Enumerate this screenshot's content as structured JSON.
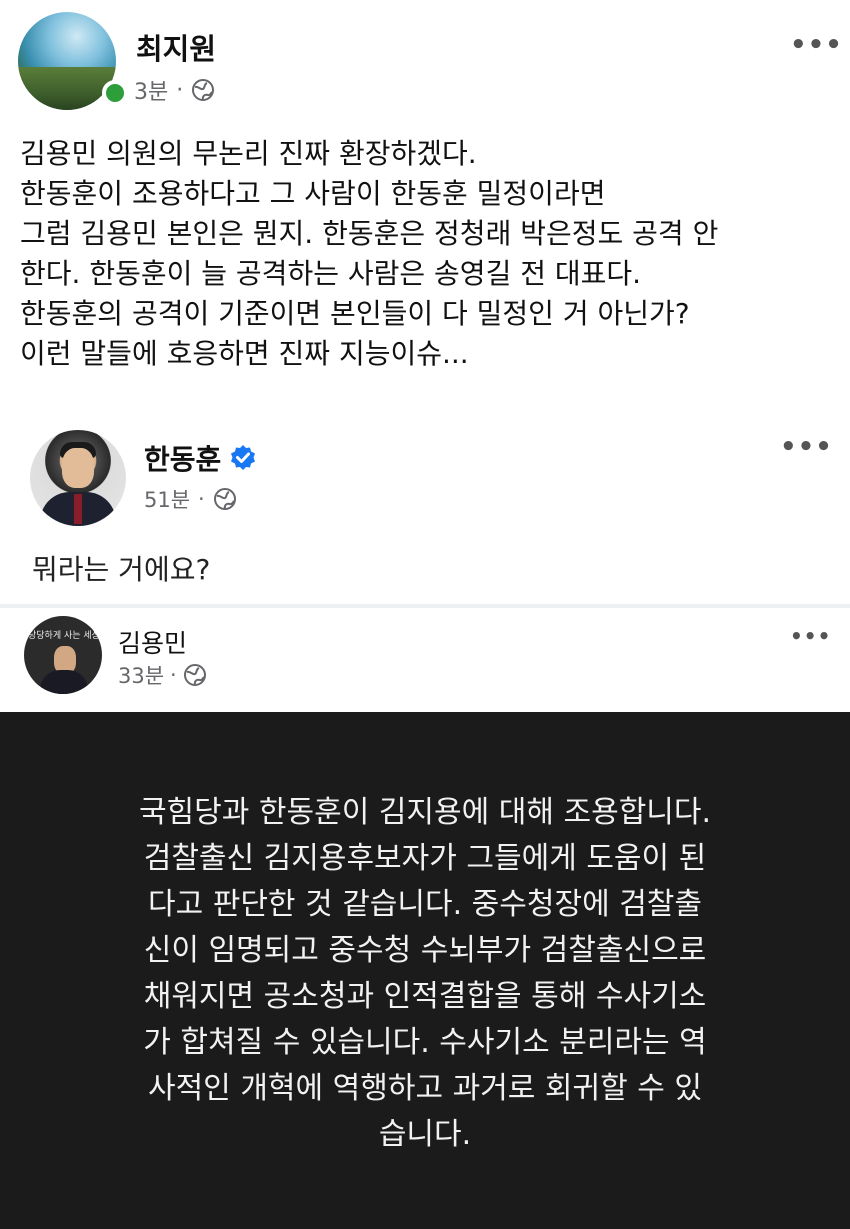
{
  "post": {
    "author": "최지원",
    "time": "3분",
    "separator": "·",
    "avatar_icon": "sea-landscape-avatar",
    "status_color": "#2e9e3a",
    "lines": [
      "김용민 의원의 무논리 진짜 환장하겠다.",
      "한동훈이 조용하다고 그 사람이 한동훈 밀정이라면",
      "그럼 김용민 본인은 뭔지. 한동훈은 정청래 박은정도 공격 안",
      "한다. 한동훈이 늘 공격하는 사람은 송영길 전 대표다.",
      "한동훈의 공격이 기준이면 본인들이 다 밀정인 거 아닌가?",
      "이런 말들에 호응하면 진짜 지능이슈..."
    ]
  },
  "shared1": {
    "author": "한동훈",
    "time": "51분",
    "separator": "·",
    "text": "뭐라는 거에요?",
    "verified_color": "#1877f2"
  },
  "shared2": {
    "author": "김용민",
    "time": "33분",
    "separator": "·",
    "avatar_caption": "당당하게 사는 세상",
    "panel_lines": [
      "국힘당과 한동훈이 김지용에 대해 조용합니다.",
      "검찰출신 김지용후보자가 그들에게 도움이 된",
      "다고 판단한 것 같습니다. 중수청장에 검찰출",
      "신이 임명되고 중수청 수뇌부가 검찰출신으로",
      "채워지면 공소청과 인적결합을 통해 수사기소",
      "가 합쳐질 수 있습니다. 수사기소 분리라는 역",
      "사적인 개혁에 역행하고 과거로 회귀할 수 있",
      "습니다."
    ]
  },
  "icons": {
    "more": "more-options-icon",
    "globe": "globe-icon",
    "verified": "verified-badge-icon"
  },
  "more_glyph": "•••"
}
